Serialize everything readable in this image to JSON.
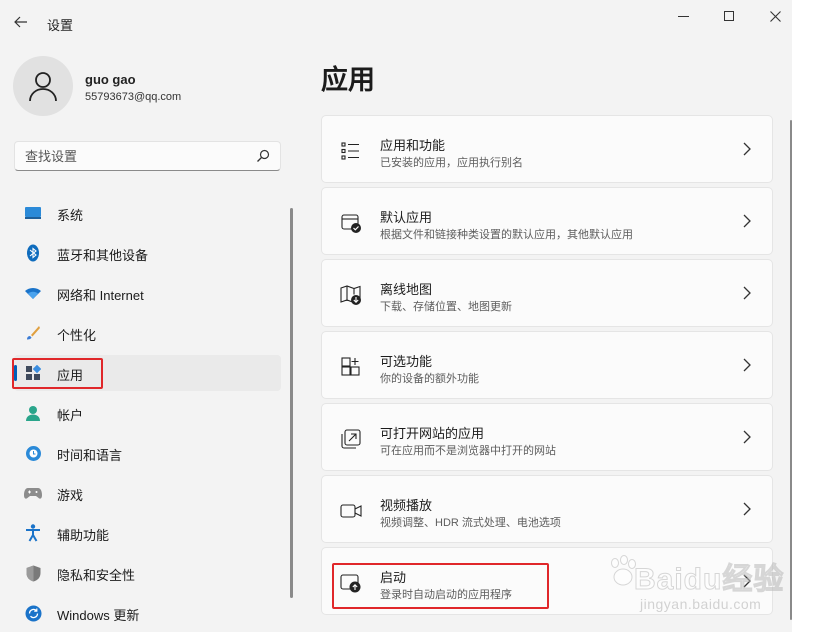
{
  "window": {
    "title": "设置",
    "back_icon": "arrow-left-icon",
    "controls": [
      "minimize-icon",
      "maximize-icon",
      "close-icon"
    ]
  },
  "profile": {
    "name": "guo gao",
    "email": "55793673@qq.com",
    "avatar_icon": "person-icon"
  },
  "search": {
    "placeholder": "查找设置",
    "icon": "search-icon"
  },
  "sidebar": {
    "items": [
      {
        "label": "系统",
        "icon": "system-display-icon"
      },
      {
        "label": "蓝牙和其他设备",
        "icon": "bluetooth-icon"
      },
      {
        "label": "网络和 Internet",
        "icon": "wifi-icon"
      },
      {
        "label": "个性化",
        "icon": "brush-icon"
      },
      {
        "label": "应用",
        "icon": "apps-icon",
        "selected": true
      },
      {
        "label": "帐户",
        "icon": "account-icon"
      },
      {
        "label": "时间和语言",
        "icon": "globe-clock-icon"
      },
      {
        "label": "游戏",
        "icon": "gamepad-icon"
      },
      {
        "label": "辅助功能",
        "icon": "accessibility-icon"
      },
      {
        "label": "隐私和安全性",
        "icon": "shield-icon"
      },
      {
        "label": "Windows 更新",
        "icon": "update-icon"
      }
    ]
  },
  "main": {
    "title": "应用",
    "cards": [
      {
        "title": "应用和功能",
        "subtitle": "已安装的应用，应用执行别名",
        "icon": "apps-list-icon"
      },
      {
        "title": "默认应用",
        "subtitle": "根据文件和链接种类设置的默认应用，其他默认应用",
        "icon": "default-apps-icon"
      },
      {
        "title": "离线地图",
        "subtitle": "下载、存储位置、地图更新",
        "icon": "offline-map-icon"
      },
      {
        "title": "可选功能",
        "subtitle": "你的设备的额外功能",
        "icon": "optional-features-icon"
      },
      {
        "title": "可打开网站的应用",
        "subtitle": "可在应用而不是浏览器中打开的网站",
        "icon": "open-website-icon"
      },
      {
        "title": "视频播放",
        "subtitle": "视频调整、HDR 流式处理、电池选项",
        "icon": "video-camera-icon"
      },
      {
        "title": "启动",
        "subtitle": "登录时自动启动的应用程序",
        "icon": "startup-icon"
      }
    ]
  },
  "watermark": {
    "brand": "Baidu经验",
    "sub": "jingyan.baidu.com"
  },
  "colors": {
    "accent": "#005fb8",
    "highlight_box": "#e0272a",
    "background": "#f3f3f3",
    "card": "#fbfbfb"
  }
}
